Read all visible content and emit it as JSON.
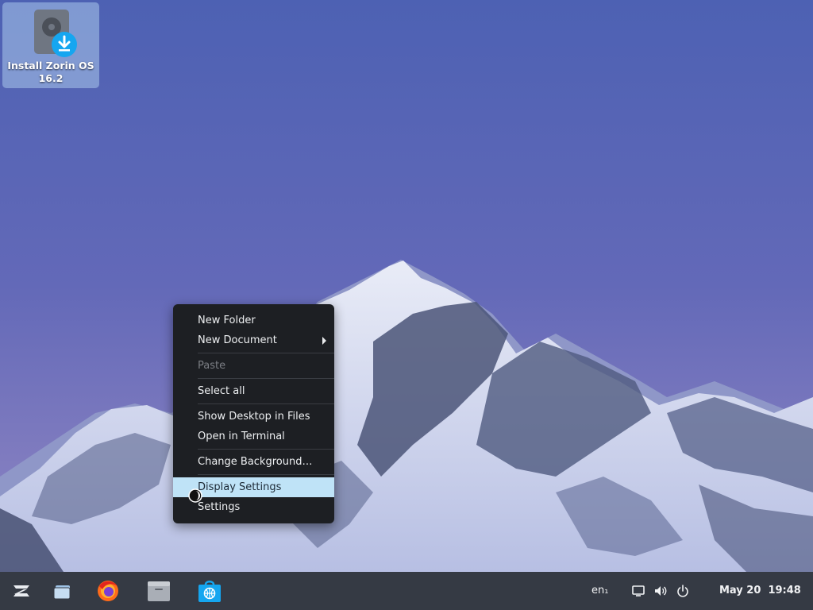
{
  "desktop": {
    "icons": [
      {
        "label": "Install Zorin OS 16.2",
        "icon": "install-disk-icon"
      }
    ]
  },
  "context_menu": {
    "items": [
      {
        "label": "New Folder",
        "enabled": true
      },
      {
        "label": "New Document",
        "enabled": true,
        "submenu": true
      },
      {
        "label": "Paste",
        "enabled": false
      },
      {
        "label": "Select all",
        "enabled": true
      },
      {
        "label": "Show Desktop in Files",
        "enabled": true
      },
      {
        "label": "Open in Terminal",
        "enabled": true
      },
      {
        "label": "Change Background…",
        "enabled": true
      },
      {
        "label": "Display Settings",
        "enabled": true,
        "highlighted": true
      },
      {
        "label": "Settings",
        "enabled": true
      }
    ]
  },
  "taskbar": {
    "launchers": [
      "zorin-menu-icon",
      "window-switcher-icon",
      "firefox-icon",
      "files-icon",
      "software-store-icon"
    ],
    "tray": {
      "keyboard_layout": "en₁",
      "date": "May 20",
      "time": "19:48",
      "icons": [
        "screen-icon",
        "volume-icon",
        "power-icon"
      ]
    }
  },
  "colors": {
    "menu_bg": "#1d1f23",
    "menu_highlight": "#bfe3f7",
    "taskbar_bg": "#353a44",
    "accent": "#15a6f0"
  }
}
